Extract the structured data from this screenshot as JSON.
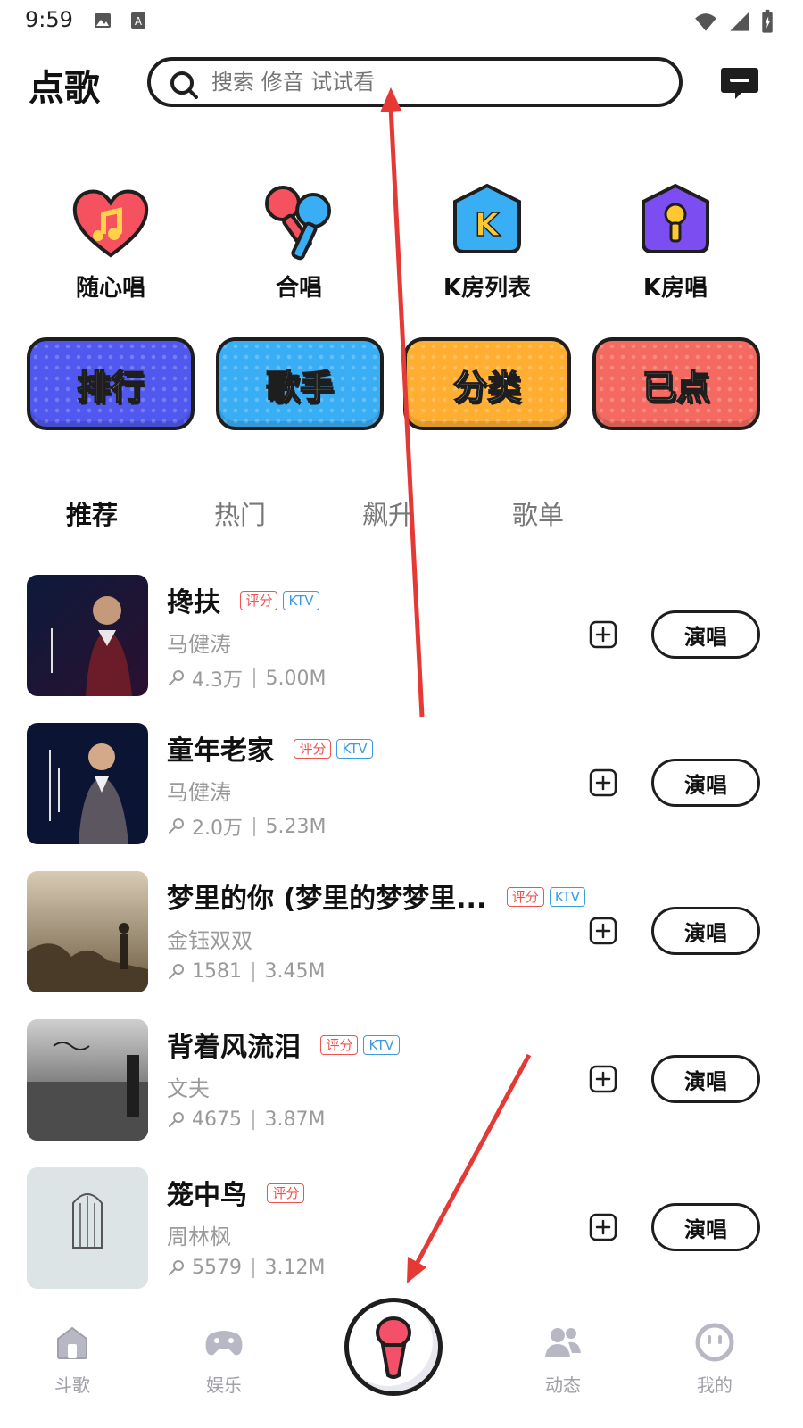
{
  "status_bar": {
    "time": "9:59"
  },
  "header": {
    "title": "点歌",
    "search_placeholder": "搜索 修音 试试看"
  },
  "quick_actions": [
    {
      "label": "随心唱",
      "icon": "heart-note-icon"
    },
    {
      "label": "合唱",
      "icon": "duet-mic-icon"
    },
    {
      "label": "K房列表",
      "icon": "k-room-icon"
    },
    {
      "label": "K房唱",
      "icon": "k-room-mic-icon"
    }
  ],
  "categories": [
    {
      "label": "排行",
      "color": "#5058f0"
    },
    {
      "label": "歌手",
      "color": "#3aaef5"
    },
    {
      "label": "分类",
      "color": "#ffae32"
    },
    {
      "label": "已点",
      "color": "#f56a60"
    }
  ],
  "tabs": [
    "推荐",
    "热门",
    "飙升",
    "歌单"
  ],
  "songs": [
    {
      "title": "搀扶",
      "artist": "马健涛",
      "plays": "4.3万",
      "size": "5.00M",
      "score_badge": "评分",
      "ktv_badge": "KTV",
      "sing_label": "演唱"
    },
    {
      "title": "童年老家",
      "artist": "马健涛",
      "plays": "2.0万",
      "size": "5.23M",
      "score_badge": "评分",
      "ktv_badge": "KTV",
      "sing_label": "演唱"
    },
    {
      "title": "梦里的你 (梦里的梦梦里...",
      "artist": "金钰双双",
      "plays": "1581",
      "size": "3.45M",
      "score_badge": "评分",
      "ktv_badge": "KTV",
      "sing_label": "演唱"
    },
    {
      "title": "背着风流泪",
      "artist": "文夫",
      "plays": "4675",
      "size": "3.87M",
      "score_badge": "评分",
      "ktv_badge": "KTV",
      "sing_label": "演唱"
    },
    {
      "title": "笼中鸟",
      "artist": "周林枫",
      "plays": "5579",
      "size": "3.12M",
      "score_badge": "评分",
      "sing_label": "演唱"
    }
  ],
  "bottom_nav": [
    {
      "label": "斗歌",
      "icon": "home-icon"
    },
    {
      "label": "娱乐",
      "icon": "gamepad-icon"
    },
    {
      "label": "动态",
      "icon": "people-icon"
    },
    {
      "label": "我的",
      "icon": "face-icon"
    }
  ],
  "colors": {
    "accent_red": "#ef5350",
    "ktv_blue": "#3d9be0",
    "annotation_arrow": "#e53935"
  }
}
